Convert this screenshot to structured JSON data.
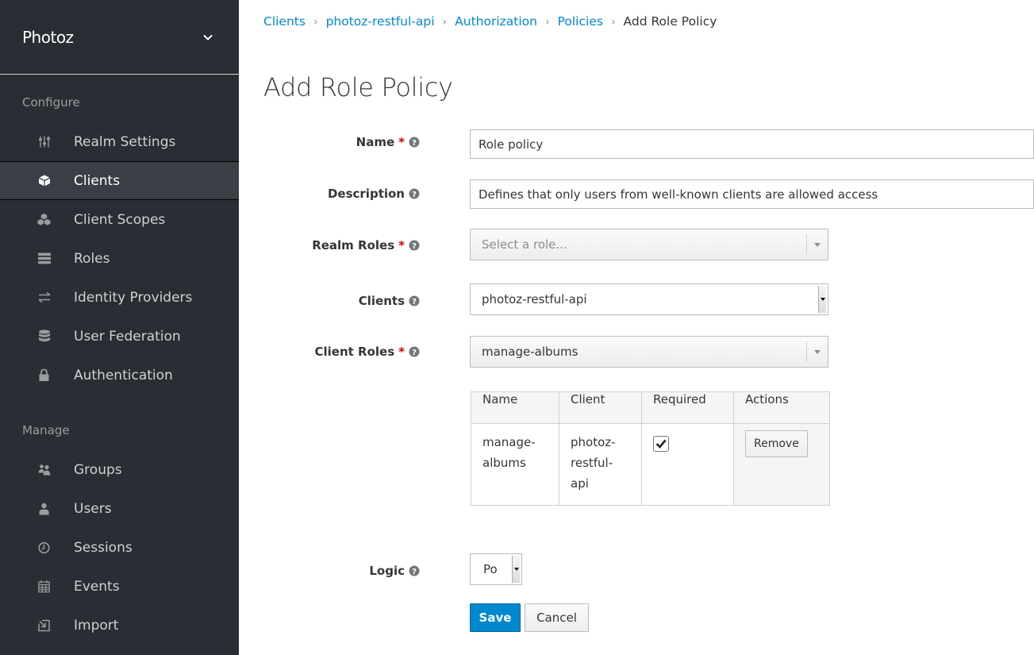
{
  "sidebar": {
    "realm": "Photoz",
    "configure_title": "Configure",
    "manage_title": "Manage",
    "configure_items": [
      {
        "label": "Realm Settings",
        "icon": "sliders-icon"
      },
      {
        "label": "Clients",
        "icon": "cube-icon",
        "active": true
      },
      {
        "label": "Client Scopes",
        "icon": "cubes-icon"
      },
      {
        "label": "Roles",
        "icon": "list-icon"
      },
      {
        "label": "Identity Providers",
        "icon": "exchange-icon"
      },
      {
        "label": "User Federation",
        "icon": "database-icon"
      },
      {
        "label": "Authentication",
        "icon": "lock-icon"
      }
    ],
    "manage_items": [
      {
        "label": "Groups",
        "icon": "users-icon"
      },
      {
        "label": "Users",
        "icon": "user-icon"
      },
      {
        "label": "Sessions",
        "icon": "clock-icon"
      },
      {
        "label": "Events",
        "icon": "calendar-icon"
      },
      {
        "label": "Import",
        "icon": "import-icon"
      }
    ]
  },
  "breadcrumb": {
    "items": [
      "Clients",
      "photoz-restful-api",
      "Authorization",
      "Policies"
    ],
    "current": "Add Role Policy"
  },
  "page_title": "Add Role Policy",
  "form": {
    "name_label": "Name",
    "name_value": "Role policy",
    "description_label": "Description",
    "description_value": "Defines that only users from well-known clients are allowed access",
    "realm_roles_label": "Realm Roles",
    "realm_roles_placeholder": "Select a role...",
    "clients_label": "Clients",
    "clients_value": "photoz-restful-api",
    "client_roles_label": "Client Roles",
    "client_roles_value": "manage-albums",
    "logic_label": "Logic",
    "logic_value": "Po"
  },
  "roles_table": {
    "headers": [
      "Name",
      "Client",
      "Required",
      "Actions"
    ],
    "rows": [
      {
        "name": "manage-albums",
        "name_lines": [
          "manage-",
          "albums"
        ],
        "client_lines": [
          "photoz-",
          "restful-",
          "api"
        ],
        "required": true,
        "action": "Remove"
      }
    ]
  },
  "buttons": {
    "save": "Save",
    "cancel": "Cancel"
  },
  "colors": {
    "sidebar_bg": "#292e34",
    "accent": "#0088ce",
    "required": "#cc0000"
  }
}
